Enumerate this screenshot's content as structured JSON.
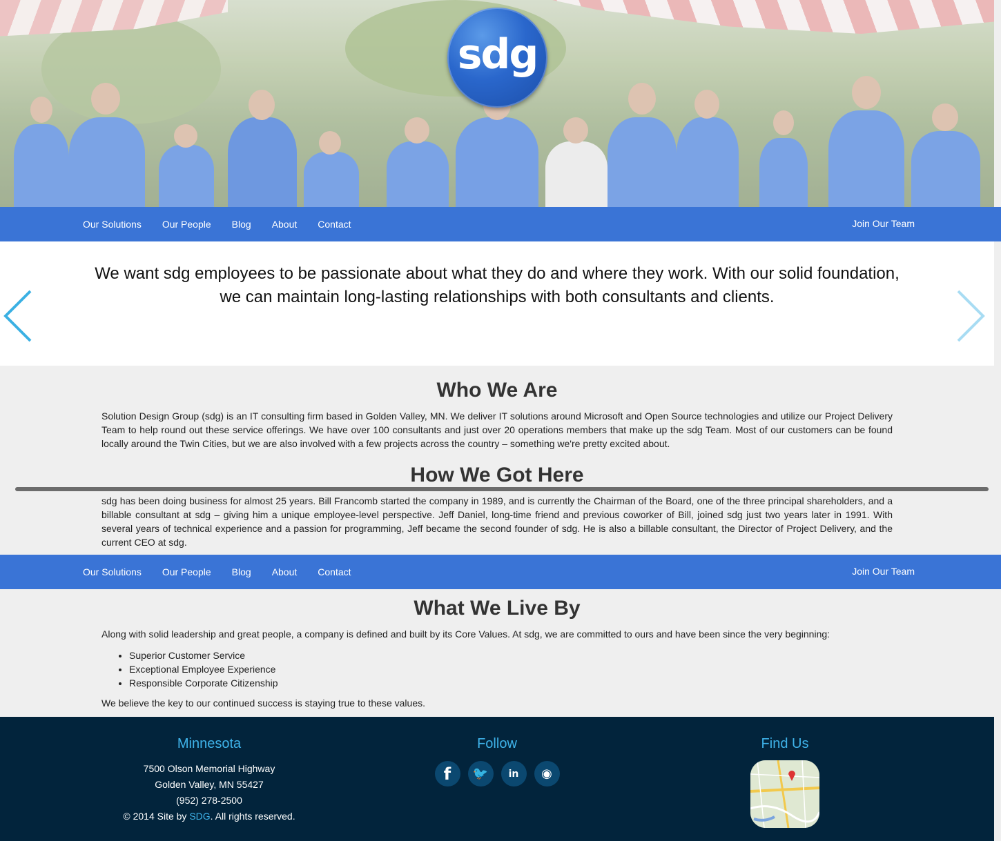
{
  "logo": {
    "text": "sdg"
  },
  "nav": {
    "items": [
      {
        "label": "Our Solutions"
      },
      {
        "label": "Our People"
      },
      {
        "label": "Blog"
      },
      {
        "label": "About"
      },
      {
        "label": "Contact"
      }
    ],
    "join": "Join Our Team"
  },
  "quote": {
    "text": "We want sdg employees to be passionate about what they do and where they work. With our solid foundation, we can maintain long-lasting relationships with both consultants and clients."
  },
  "who": {
    "title": "Who We Are",
    "body": "Solution Design Group (sdg) is an IT consulting firm based in Golden Valley, MN. We deliver IT solutions around Microsoft and Open Source technologies and utilize our Project Delivery Team to help round out these service offerings. We have over 100 consultants and just over 20 operations members that make up the sdg Team. Most of our customers can be found locally around the Twin Cities, but we are also involved with a few projects across the country – something we're pretty excited about."
  },
  "how": {
    "title": "How We Got Here",
    "body": "sdg has been doing business for almost 25 years. Bill Francomb started the company in 1989, and is currently the Chairman of the Board, one of the three principal shareholders, and a billable consultant at sdg – giving him a unique employee-level perspective. Jeff Daniel, long-time friend and previous coworker of Bill, joined sdg just two years later in 1991. With several years of technical experience and a passion for programming, Jeff became the second founder of sdg. He is also a billable consultant, the Director of Project Delivery, and the current CEO at sdg."
  },
  "live": {
    "title": "What We Live By",
    "intro": "Along with solid leadership and great people, a company is defined and built by its Core Values. At sdg, we are committed to ours and have been since the very beginning:",
    "values": [
      "Superior Customer Service",
      "Exceptional Employee Experience",
      "Responsible Corporate Citizenship"
    ],
    "outro": "We believe the key to our continued success is staying true to these values."
  },
  "footer": {
    "minnesota": {
      "title": "Minnesota",
      "line1": "7500 Olson Memorial Highway",
      "line2": "Golden Valley, MN 55427",
      "phone": "(952) 278-2500",
      "copy_pre": "© 2014 Site by ",
      "copy_link": "SDG",
      "copy_post": ". All rights reserved."
    },
    "follow": {
      "title": "Follow",
      "icons": [
        {
          "name": "facebook-icon",
          "glyph": "f"
        },
        {
          "name": "twitter-icon",
          "glyph": "🐦"
        },
        {
          "name": "linkedin-icon",
          "glyph": "in"
        },
        {
          "name": "rss-icon",
          "glyph": "◉"
        }
      ]
    },
    "find": {
      "title": "Find Us"
    }
  },
  "colors": {
    "nav": "#3a74d6",
    "footer": "#02243c",
    "accent": "#3fb3ea",
    "arrow": "#3ab0e3"
  }
}
